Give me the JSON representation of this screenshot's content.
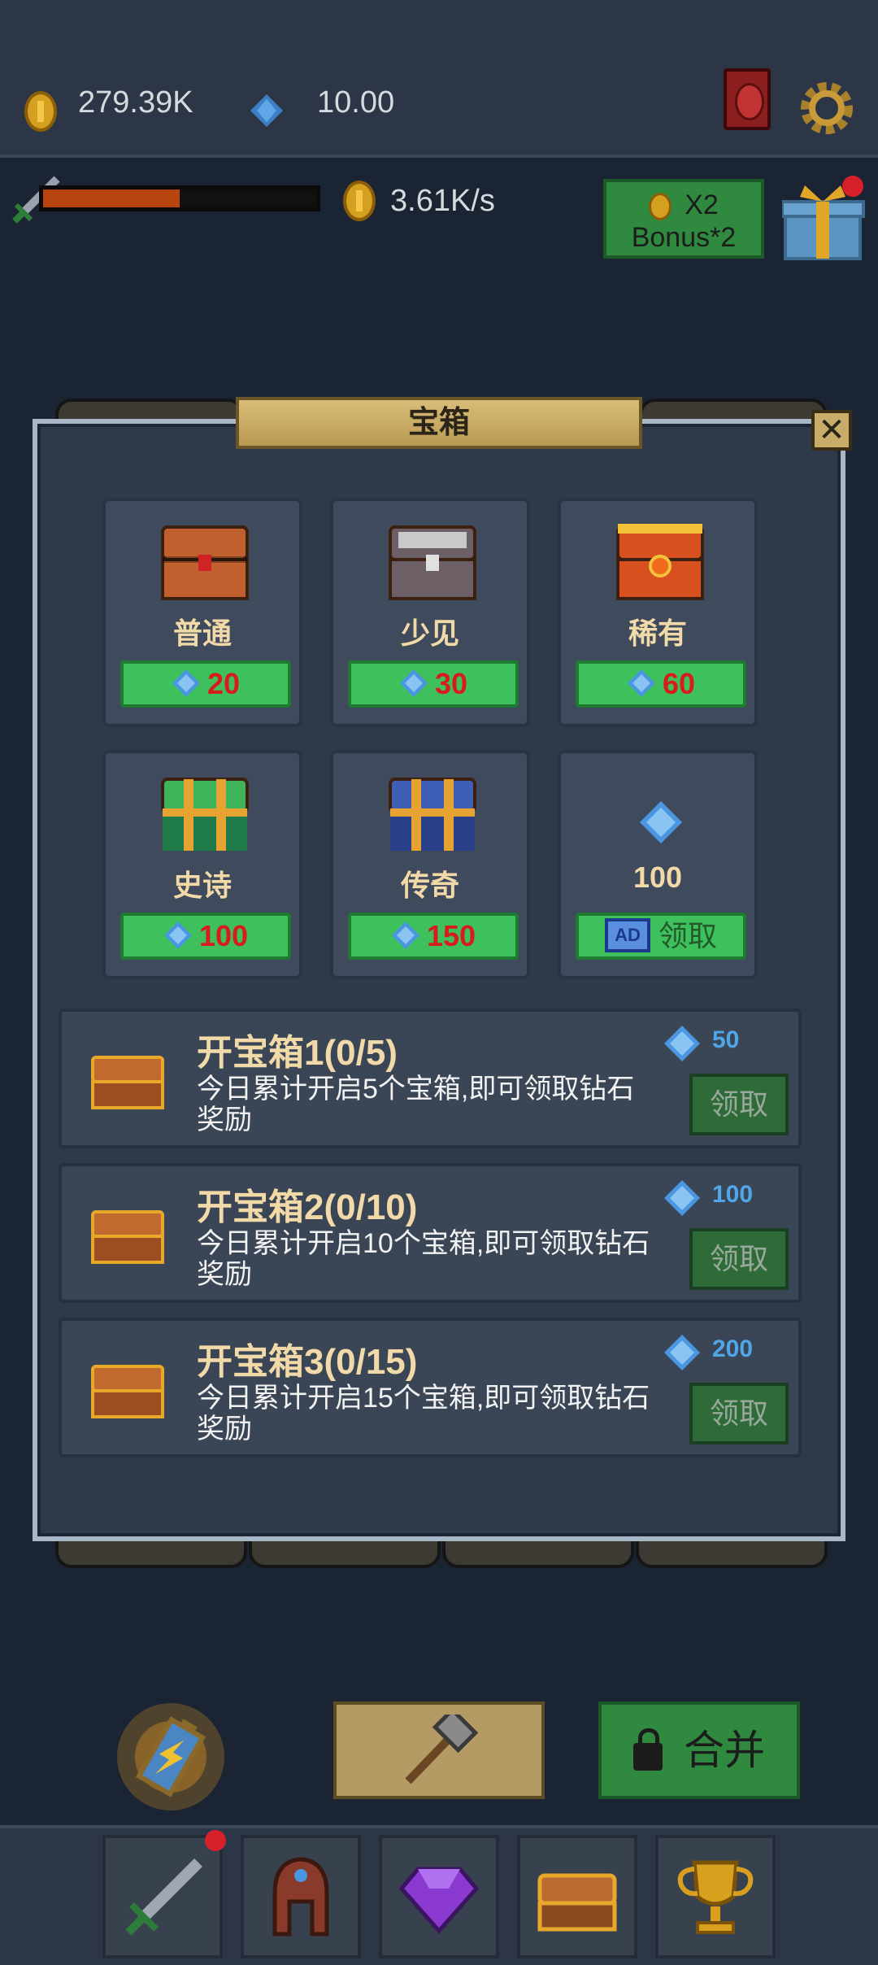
{
  "status": {
    "gold": "279.39K",
    "gems": "10.00",
    "income_rate": "3.61K/s",
    "hp_fraction": 0.5
  },
  "header": {
    "bonus_button": {
      "line1": "X2",
      "line2": "Bonus*2"
    }
  },
  "panel": {
    "title": "宝箱",
    "close_label": "✕",
    "chests": [
      {
        "name": "普通",
        "price": "20",
        "color": "#c0602e"
      },
      {
        "name": "少见",
        "price": "30",
        "color": "#6d5f66"
      },
      {
        "name": "稀有",
        "price": "60",
        "color": "#d8501e"
      },
      {
        "name": "史诗",
        "price": "100",
        "color": "#3fb35a"
      },
      {
        "name": "传奇",
        "price": "150",
        "color": "#3f5fb6"
      }
    ],
    "ad_reward": {
      "amount": "100",
      "ad_label": "AD",
      "claim_label": "领取"
    },
    "tasks": [
      {
        "title": "开宝箱1(0/5)",
        "desc": "今日累计开启5个宝箱,即可领取钻石奖励",
        "reward": "50",
        "claim": "领取"
      },
      {
        "title": "开宝箱2(0/10)",
        "desc": "今日累计开启10个宝箱,即可领取钻石奖励",
        "reward": "100",
        "claim": "领取"
      },
      {
        "title": "开宝箱3(0/15)",
        "desc": "今日累计开启15个宝箱,即可领取钻石奖励",
        "reward": "200",
        "claim": "领取"
      }
    ]
  },
  "actions": {
    "merge_label": "合并"
  },
  "bottom_nav": [
    "sword",
    "helmet",
    "gem",
    "chest",
    "trophy"
  ]
}
